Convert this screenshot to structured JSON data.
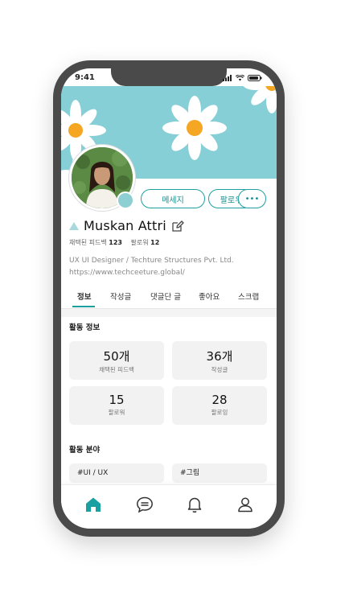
{
  "status_bar": {
    "time": "9:41"
  },
  "profile": {
    "name": "Muskan Attri",
    "stats": [
      {
        "label": "채택된 피드백",
        "value": "123"
      },
      {
        "label": "팔로워",
        "value": "12"
      }
    ],
    "bio_line1": "UX UI Designer / Techture Structures Pvt. Ltd.",
    "bio_line2": "https://www.techceeture.global/"
  },
  "actions": {
    "message_label": "메세지",
    "follow_label": "팔로우",
    "more_label": "•••"
  },
  "tabs": [
    {
      "label": "정보",
      "active": true
    },
    {
      "label": "작성글",
      "active": false
    },
    {
      "label": "댓글단 글",
      "active": false
    },
    {
      "label": "좋아요",
      "active": false
    },
    {
      "label": "스크랩",
      "active": false
    }
  ],
  "activity": {
    "title": "활동 정보",
    "cards": [
      {
        "value": "50개",
        "label": "채택된 피드백"
      },
      {
        "value": "36개",
        "label": "작성글"
      },
      {
        "value": "15",
        "label": "팔로워"
      },
      {
        "value": "28",
        "label": "팔로잉"
      }
    ]
  },
  "fields": {
    "title": "활동 분야",
    "tags": [
      "#UI / UX",
      "#그림"
    ]
  },
  "bottom_nav": [
    "home-icon",
    "chat-icon",
    "bell-icon",
    "user-icon"
  ],
  "colors": {
    "accent": "#1aa0a0",
    "cover": "#86cfd6",
    "avatar_dot": "#8ecfd3"
  }
}
